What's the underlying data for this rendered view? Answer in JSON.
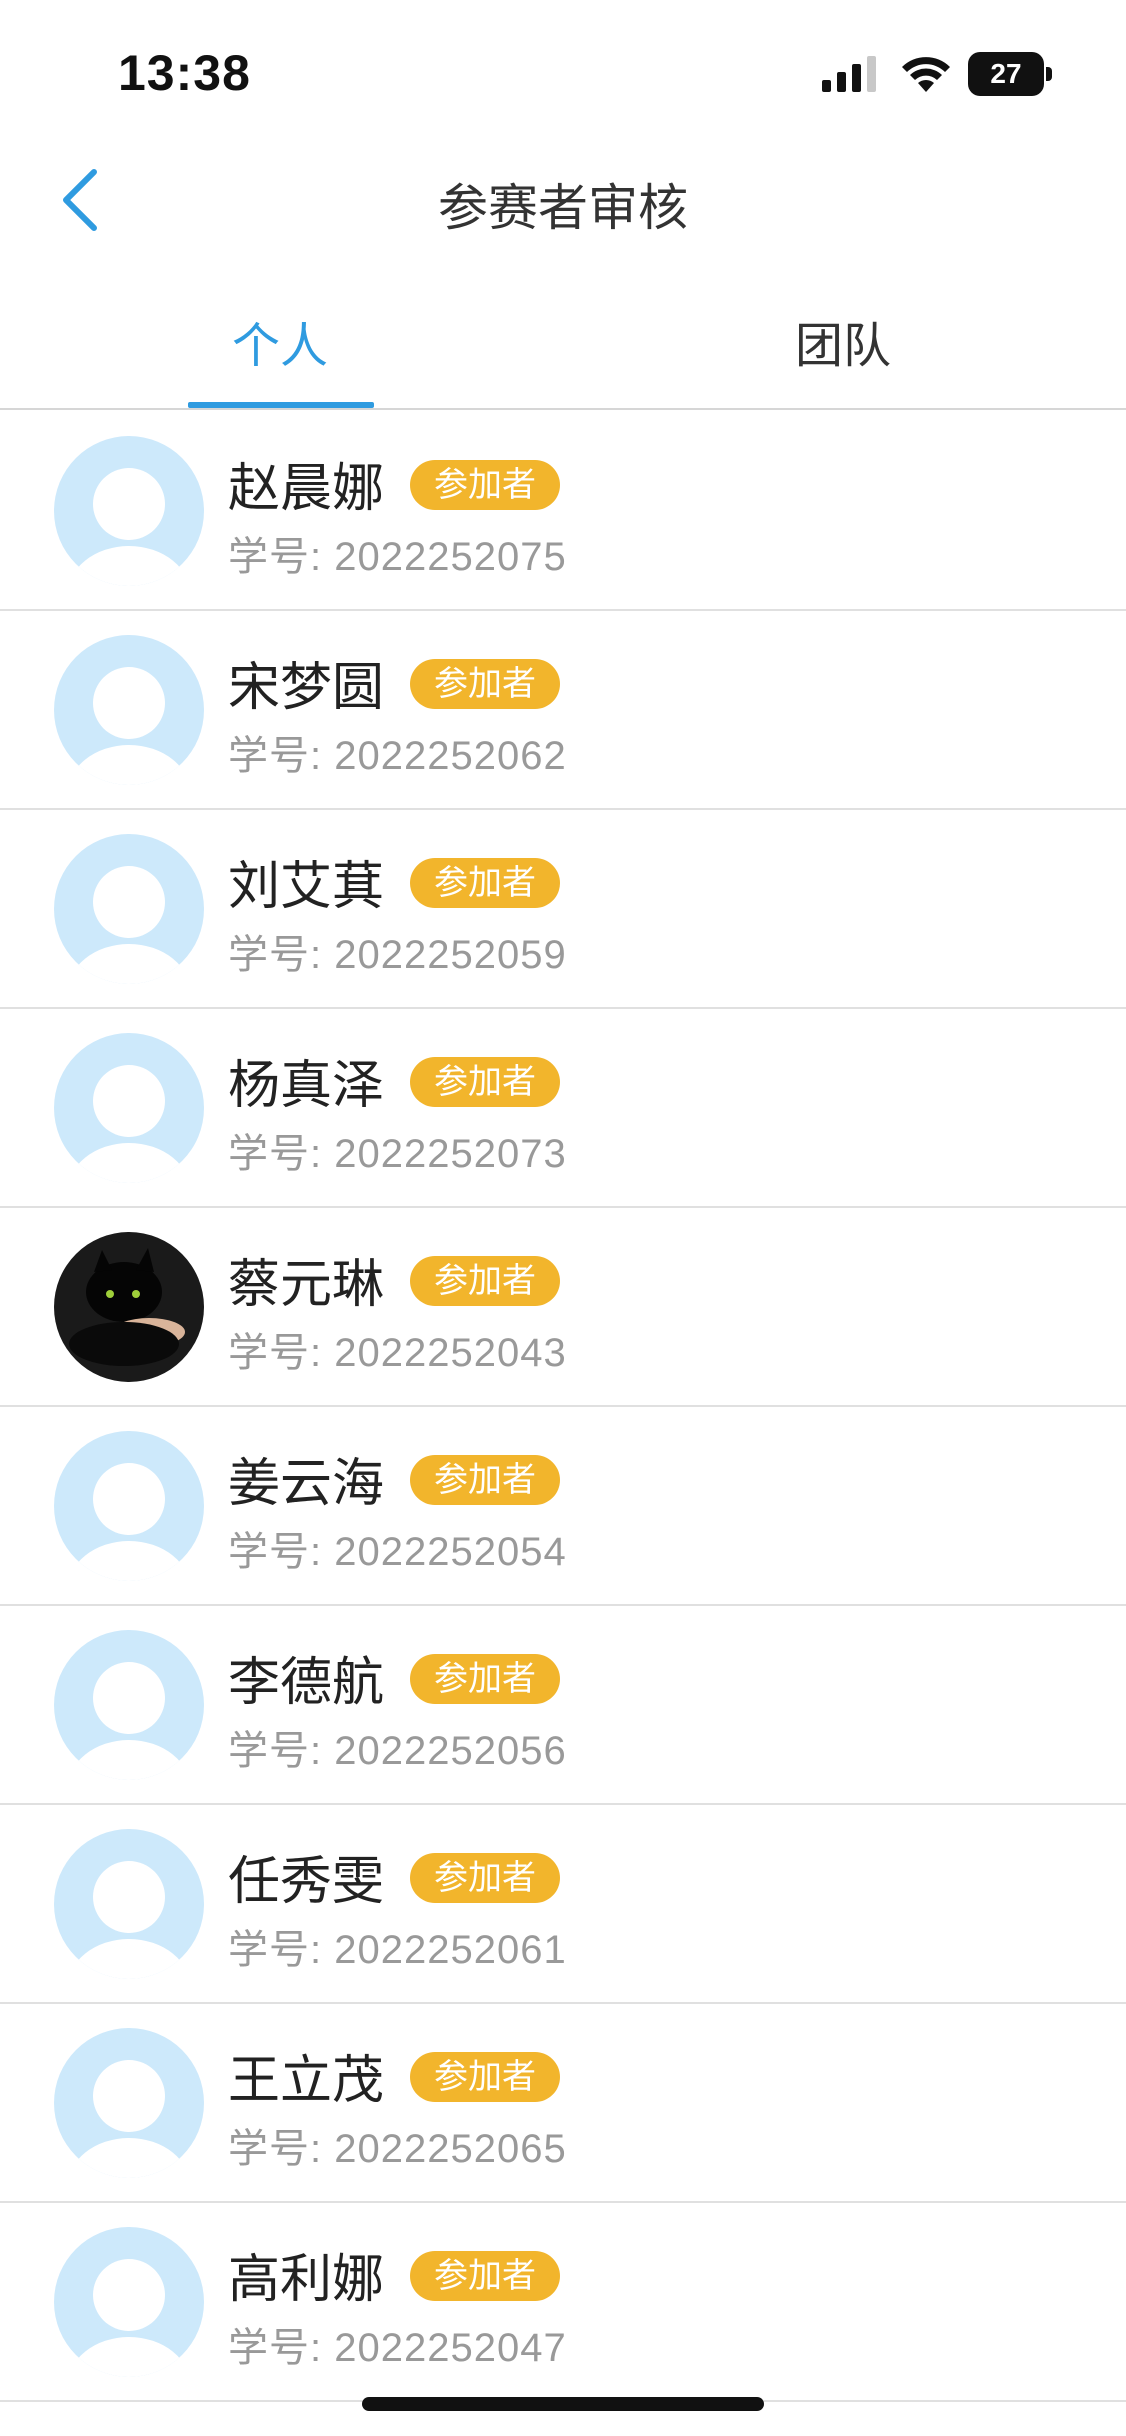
{
  "status": {
    "time": "13:38",
    "battery": "27"
  },
  "nav": {
    "title": "参赛者审核"
  },
  "tabs": [
    {
      "label": "个人",
      "active": true
    },
    {
      "label": "团队",
      "active": false
    }
  ],
  "id_prefix": "学号: ",
  "participants": [
    {
      "name": "赵晨娜",
      "badge": "参加者",
      "student_id": "学号: 2022252075",
      "avatar": "default-avatar"
    },
    {
      "name": "宋梦圆",
      "badge": "参加者",
      "student_id": "学号: 2022252062",
      "avatar": "default-avatar"
    },
    {
      "name": "刘艾萁",
      "badge": "参加者",
      "student_id": "学号: 2022252059",
      "avatar": "default-avatar"
    },
    {
      "name": "杨真泽",
      "badge": "参加者",
      "student_id": "学号: 2022252073",
      "avatar": "default-avatar"
    },
    {
      "name": "蔡元琳",
      "badge": "参加者",
      "student_id": "学号: 2022252043",
      "avatar": "black-cat-photo"
    },
    {
      "name": "姜云海",
      "badge": "参加者",
      "student_id": "学号: 2022252054",
      "avatar": "default-avatar"
    },
    {
      "name": "李德航",
      "badge": "参加者",
      "student_id": "学号: 2022252056",
      "avatar": "default-avatar"
    },
    {
      "name": "任秀雯",
      "badge": "参加者",
      "student_id": "学号: 2022252061",
      "avatar": "default-avatar"
    },
    {
      "name": "王立茂",
      "badge": "参加者",
      "student_id": "学号: 2022252065",
      "avatar": "default-avatar"
    },
    {
      "name": "高利娜",
      "badge": "参加者",
      "student_id": "学号: 2022252047",
      "avatar": "default-avatar"
    }
  ],
  "colors": {
    "accent": "#2f9be0",
    "badge": "#f2b52c",
    "avatar_placeholder": "#cde9fb"
  }
}
